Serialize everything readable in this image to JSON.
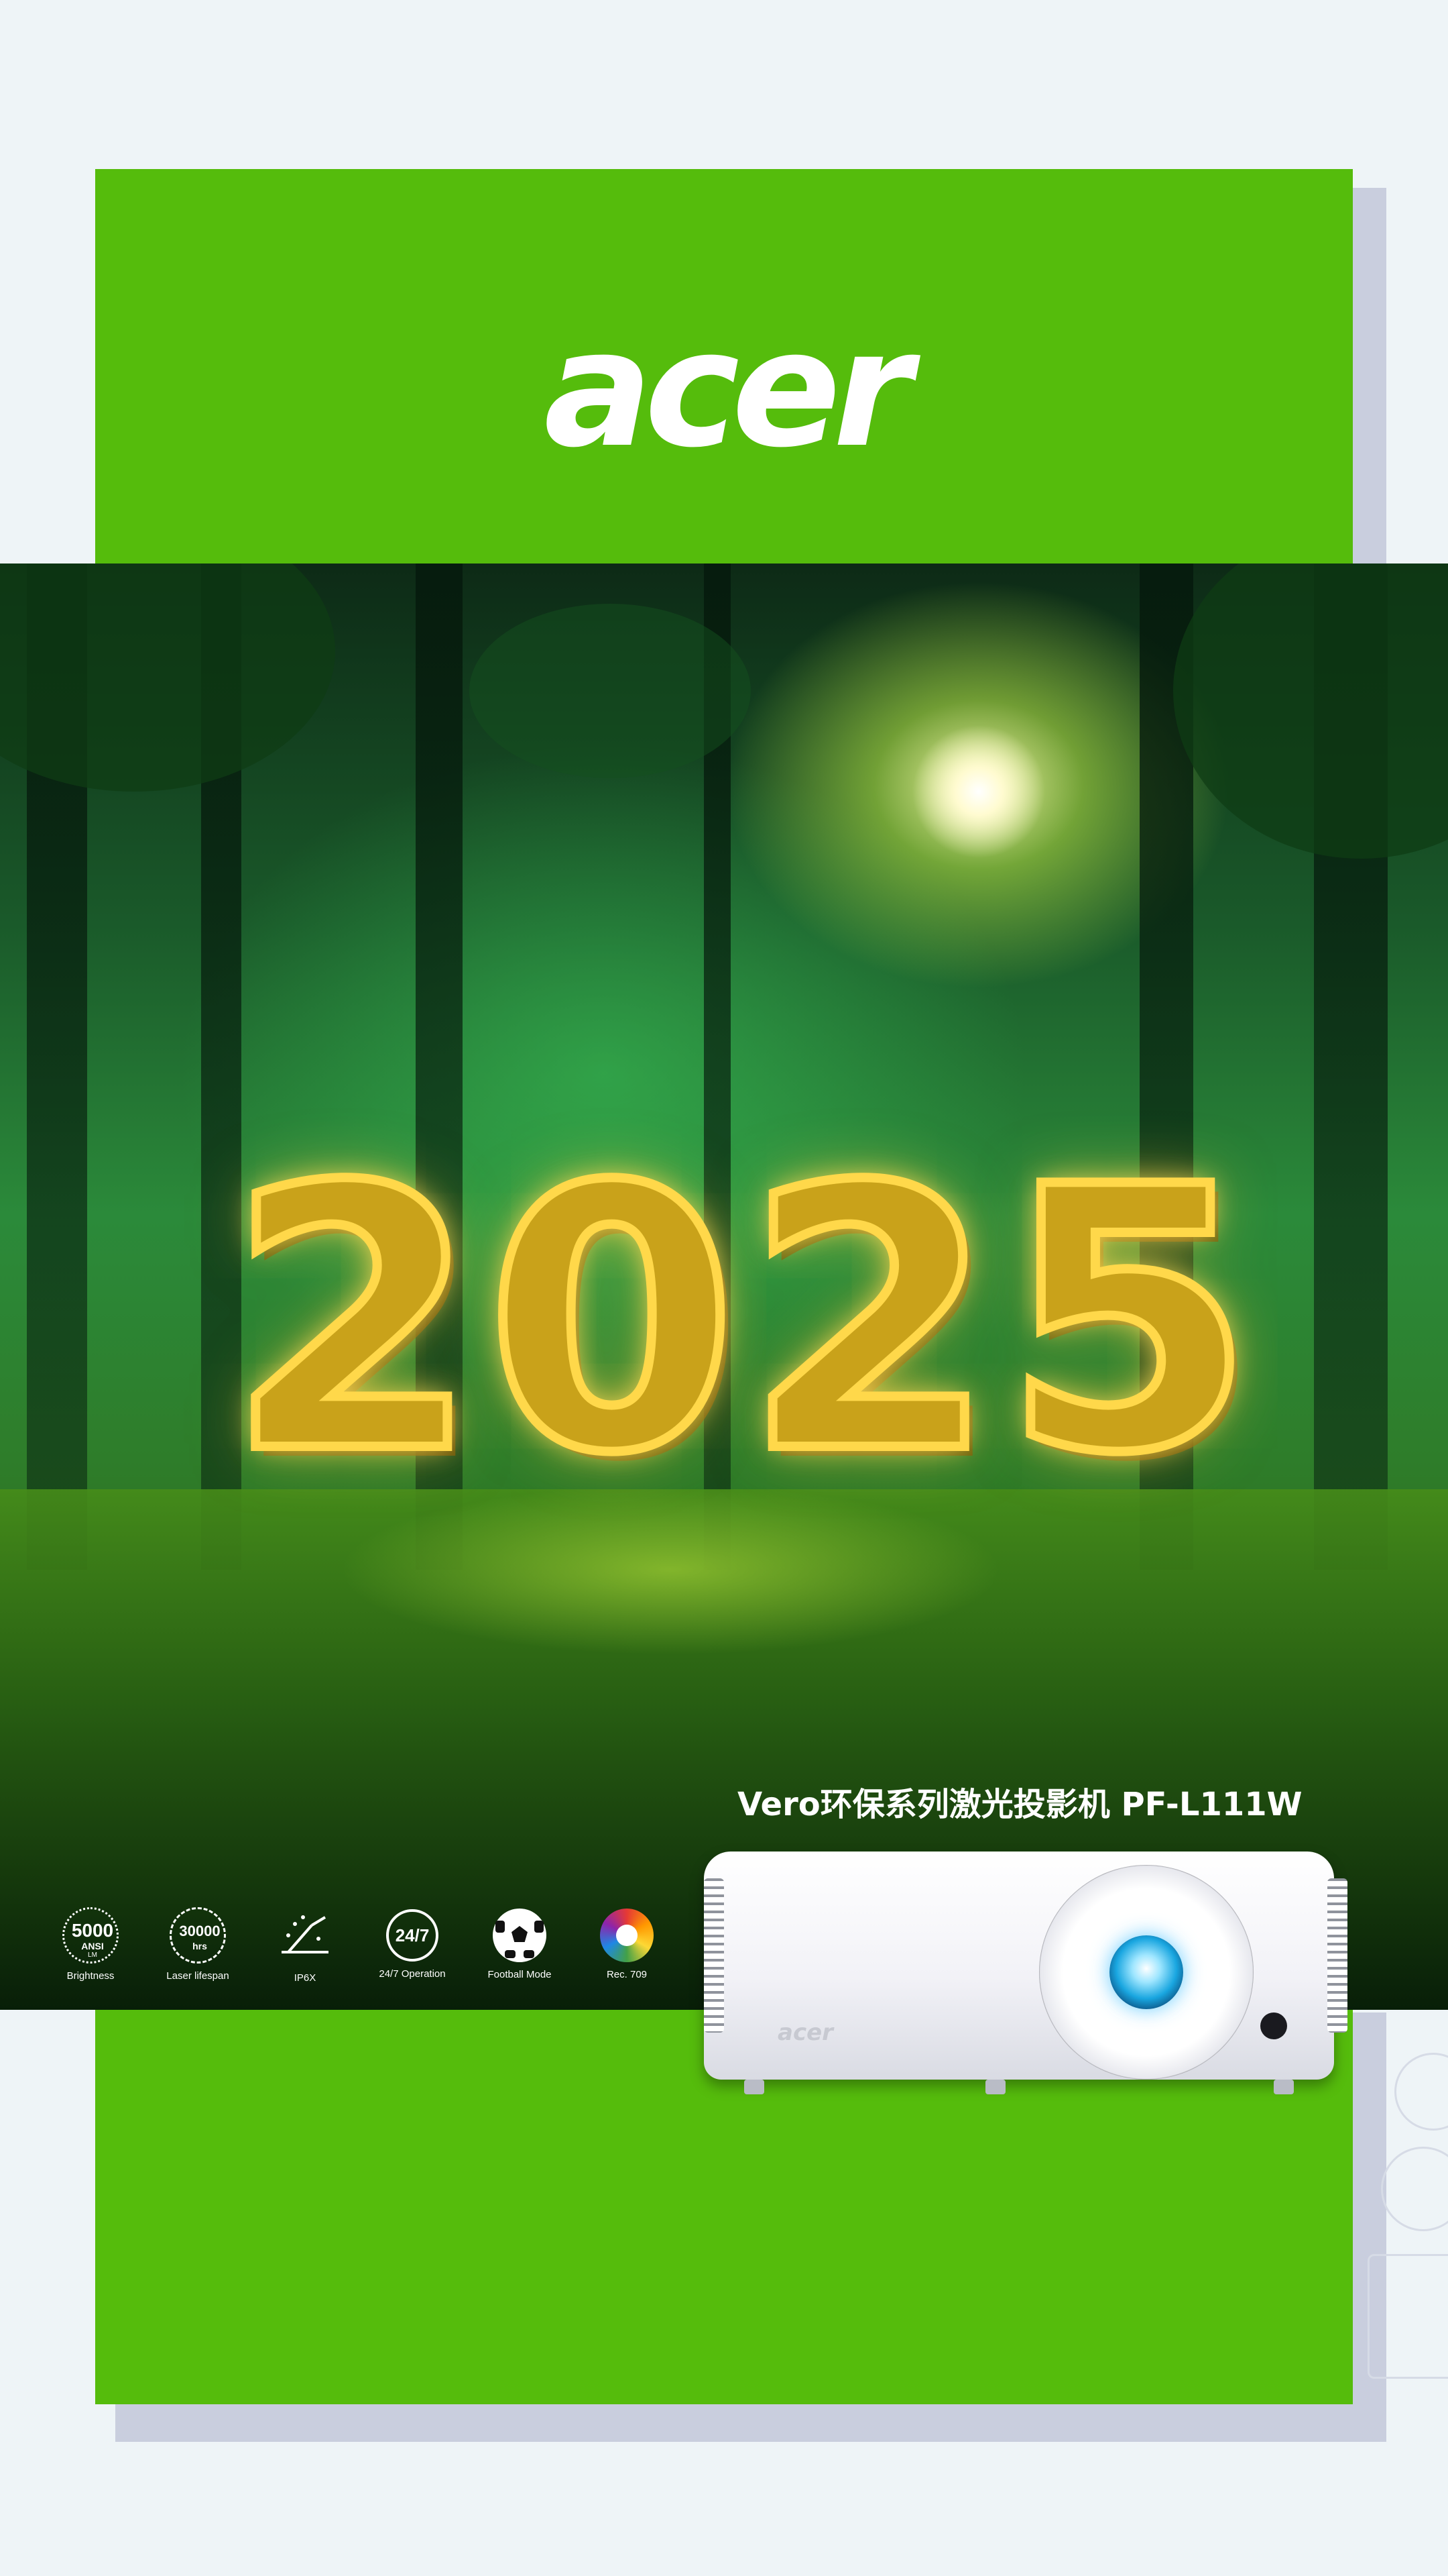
{
  "brand": {
    "logo_text": "acer",
    "accent_color": "#55bc0c"
  },
  "hero": {
    "year": "2025"
  },
  "product": {
    "title": "Vero环保系列激光投影机 PF-L111W",
    "body_brand": "acer"
  },
  "features": [
    {
      "icon": "brightness-icon",
      "main": "5000",
      "sub": "ANSI",
      "unit": "LM",
      "label": "Brightness"
    },
    {
      "icon": "laser-lifespan-icon",
      "main": "30000",
      "sub": "hrs",
      "label": "Laser lifespan"
    },
    {
      "icon": "ip6x-icon",
      "label": "IP6X"
    },
    {
      "icon": "clock-24-7-icon",
      "main": "24/7",
      "label": "24/7 Operation"
    },
    {
      "icon": "football-icon",
      "label": "Football Mode"
    },
    {
      "icon": "color-wheel-icon",
      "label": "Rec. 709"
    }
  ]
}
